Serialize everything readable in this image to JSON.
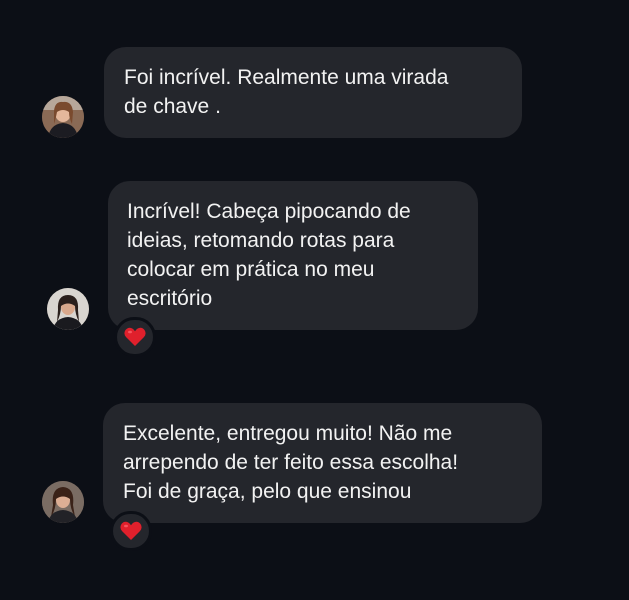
{
  "colors": {
    "background": "#0c0f16",
    "bubble": "#24262c",
    "text": "#f2f2f2",
    "heart": "#e0202c"
  },
  "messages": [
    {
      "lines": [
        "Foi incrível. Realmente uma virada",
        "de chave ."
      ],
      "avatar_icon": "user-avatar-icon",
      "reaction": null
    },
    {
      "lines": [
        "Incrível! Cabeça pipocando de",
        "ideias, retomando rotas para",
        "colocar em prática no meu",
        "escritório"
      ],
      "avatar_icon": "user-avatar-icon",
      "reaction": "red-heart-icon"
    },
    {
      "lines": [
        "Excelente, entregou muito! Não me",
        "arrependo de ter feito essa escolha!",
        "Foi de graça, pelo que ensinou"
      ],
      "avatar_icon": "user-avatar-icon",
      "reaction": "red-heart-icon"
    }
  ]
}
